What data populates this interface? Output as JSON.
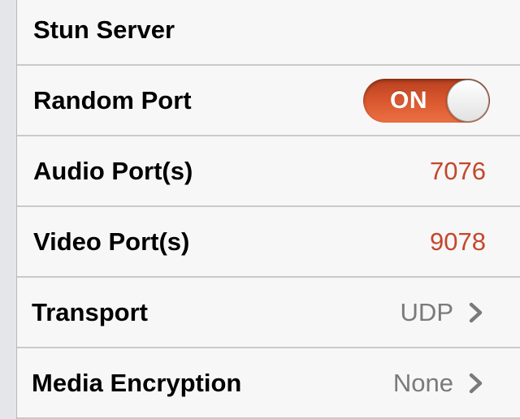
{
  "settings": {
    "rows": [
      {
        "label": "Stun Server"
      },
      {
        "label": "Random Port",
        "toggle": "ON"
      },
      {
        "label": "Audio Port(s)",
        "value": "7076"
      },
      {
        "label": "Video Port(s)",
        "value": "9078"
      },
      {
        "label": "Transport",
        "value": "UDP",
        "icon": "chevron-right-icon"
      },
      {
        "label": "Media Encryption",
        "value": "None",
        "icon": "chevron-right-icon"
      }
    ]
  },
  "colors": {
    "accent": "#c5472c",
    "toggle_on": "#d7552d",
    "detail_text": "#7a7a7a",
    "cell_background": "#f7f7f7",
    "page_background": "#e4e6ea"
  }
}
